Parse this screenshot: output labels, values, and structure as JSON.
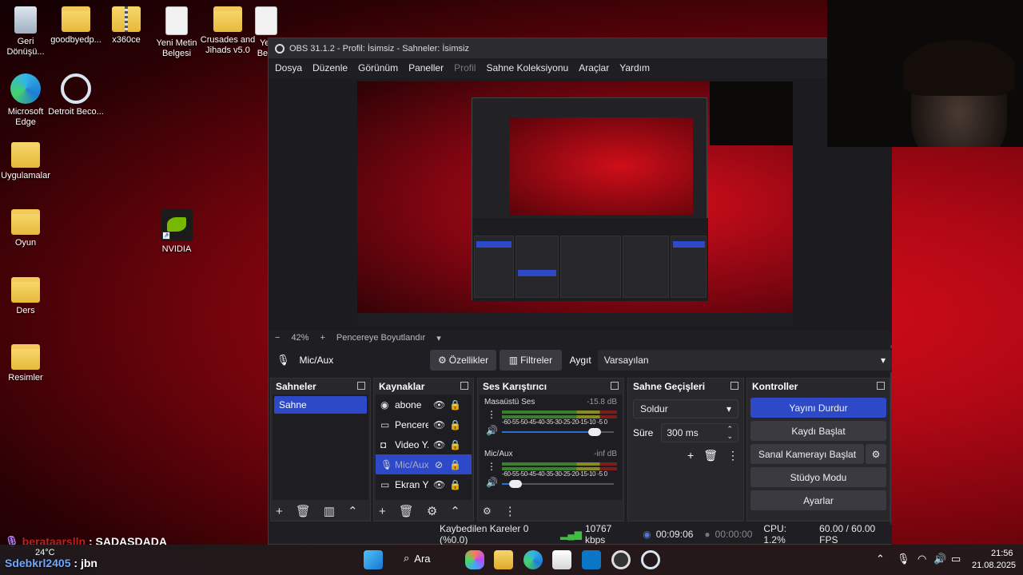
{
  "desktop": {
    "icons": [
      {
        "label": "Geri Dönüşü..."
      },
      {
        "label": "goodbyedp..."
      },
      {
        "label": "x360ce"
      },
      {
        "label": "Yeni Metin Belgesi"
      },
      {
        "label": "Crusades and Jihads v5.0"
      },
      {
        "label": "Yer Be..."
      },
      {
        "label": "Microsoft Edge"
      },
      {
        "label": "Detroit Beco..."
      },
      {
        "label": "Uygulamalar"
      },
      {
        "label": "NVIDIA"
      },
      {
        "label": "Oyun"
      },
      {
        "label": "Ders"
      },
      {
        "label": "Resimler"
      }
    ]
  },
  "obs": {
    "title": "OBS 31.1.2 - Profil: İsimsiz - Sahneler: İsimsiz",
    "minimize": "—",
    "menu": [
      "Dosya",
      "Düzenle",
      "Görünüm",
      "Paneller",
      "Profil",
      "Sahne Koleksiyonu",
      "Araçlar",
      "Yardım"
    ],
    "zoom": {
      "minus": "−",
      "value": "42%",
      "plus": "+",
      "mode": "Pencereye Boyutlandır",
      "caret": "▾"
    },
    "source_bar": {
      "selected_source": "Mic/Aux",
      "properties": "Özellikler",
      "filters": "Filtreler",
      "device_label": "Aygıt",
      "device_value": "Varsayılan",
      "caret": "▾"
    },
    "scenes": {
      "title": "Sahneler",
      "items": [
        "Sahne"
      ]
    },
    "sources": {
      "title": "Kaynaklar",
      "items": [
        {
          "label": "abone",
          "icon": "globe-icon",
          "glyph": "◉"
        },
        {
          "label": "Pencere",
          "icon": "window-icon",
          "glyph": "▭"
        },
        {
          "label": "Video Y...",
          "icon": "camera-icon",
          "glyph": "◘"
        },
        {
          "label": "Mic/Aux",
          "icon": "mic-icon",
          "glyph": "🎙"
        },
        {
          "label": "Ekran Y...",
          "icon": "monitor-icon",
          "glyph": "▭"
        }
      ]
    },
    "mixer": {
      "title": "Ses Karıştırıcı",
      "scale": "-60-55-50-45-40-35-30-25-20-15-10 -5 0",
      "channels": [
        {
          "name": "Masaüstü Ses",
          "db": "-15.8 dB",
          "volume": 0.83
        },
        {
          "name": "Mic/Aux",
          "db": "-inf dB",
          "volume": 0.12
        }
      ]
    },
    "transitions": {
      "title": "Sahne Geçişleri",
      "type": "Soldur",
      "duration_label": "Süre",
      "duration_value": "300 ms"
    },
    "controls": {
      "title": "Kontroller",
      "stop_stream": "Yayını Durdur",
      "start_record": "Kaydı Başlat",
      "virtual_cam": "Sanal Kamerayı Başlat",
      "studio_mode": "Stüdyo Modu",
      "settings": "Ayarlar"
    },
    "status": {
      "dropped": "Kaybedilen Kareler 0 (%0.0)",
      "bitrate": "10767 kbps",
      "stream_time": "00:09:06",
      "record_time": "00:00:00",
      "cpu": "CPU: 1.2%",
      "fps": "60.00 / 60.00 FPS"
    }
  },
  "chat": [
    {
      "user": "berataarslln",
      "message": ": SADASDADA"
    },
    {
      "user": "Sdebkrl2405",
      "message": ": jbn"
    }
  ],
  "weather": "24°C",
  "taskbar": {
    "search": "Ara",
    "time": "21:56",
    "date": "21.08.2025"
  },
  "colors": {
    "accent": "#2d49c8",
    "obs_bg": "#1f1f23",
    "desktop_red": "#c40a15"
  }
}
